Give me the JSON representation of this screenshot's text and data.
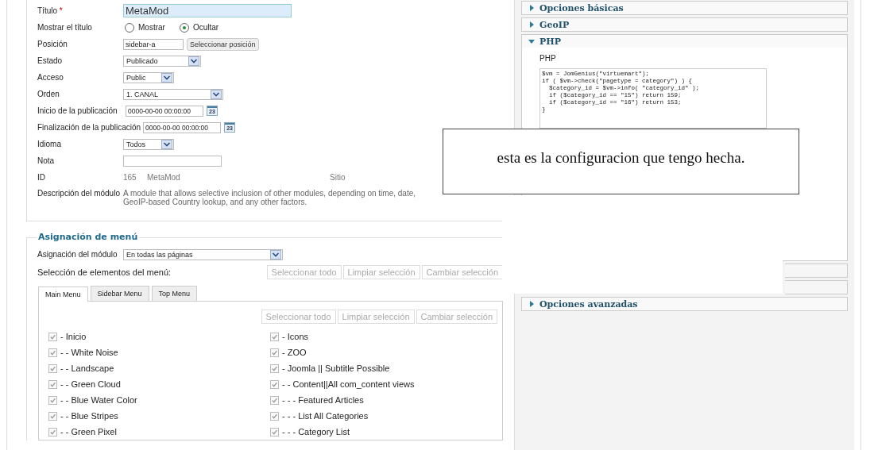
{
  "details": {
    "fields": [
      {
        "kind": "title",
        "label": "Título",
        "mark": "*",
        "value": "MetaMod"
      },
      {
        "kind": "radio",
        "label": "Mostrar el título",
        "options": [
          {
            "label": "Mostrar",
            "selected": false
          },
          {
            "label": "Ocultar",
            "selected": true
          }
        ]
      },
      {
        "kind": "position",
        "label": "Posición",
        "value": "sidebar-a",
        "button": "Seleccionar posición"
      },
      {
        "kind": "select",
        "label": "Estado",
        "value": "Publicado"
      },
      {
        "kind": "select",
        "label": "Acceso",
        "value": "Public"
      },
      {
        "kind": "select",
        "label": "Orden",
        "value": "1. CANAL"
      },
      {
        "kind": "date",
        "label": "Inicio de la publicación",
        "value": "0000-00-00 00:00:00",
        "day": "23"
      },
      {
        "kind": "date",
        "label": "Finalización de la publicación",
        "value": "0000-00-00 00:00:00",
        "day": "23"
      },
      {
        "kind": "select",
        "label": "Idioma",
        "value": "Todos"
      },
      {
        "kind": "text",
        "label": "Nota"
      },
      {
        "kind": "info",
        "label": "ID",
        "values": [
          "165",
          "MetaMod",
          "Sitio"
        ]
      },
      {
        "kind": "description",
        "label": "Descripción del módulo",
        "text": "A module that allows selective inclusion of other modules, depending on time, date, GeoIP-based Country lookup, and any other factors."
      }
    ]
  },
  "menu_assignment": {
    "legend": "Asignación de menú",
    "assignment_label": "Asignación del módulo",
    "assignment_value": "En todas las páginas",
    "selection_label": "Selección de elementos del menú:",
    "buttons": [
      "Seleccionar todo",
      "Limpiar selección",
      "Cambiar selección"
    ],
    "tabs": [
      {
        "label": "Main Menu",
        "selected": true
      },
      {
        "label": "Sidebar Menu",
        "selected": false
      },
      {
        "label": "Top Menu",
        "selected": false
      }
    ],
    "tab_buttons": [
      "Seleccionar todo",
      "Limpiar selección",
      "Cambiar selección"
    ],
    "columns": [
      [
        {
          "label": "- Inicio",
          "checked": true
        },
        {
          "label": "- - White Noise",
          "checked": true
        },
        {
          "label": "- - Landscape",
          "checked": true
        },
        {
          "label": "- - Green Cloud",
          "checked": true
        },
        {
          "label": "- - Blue Water Color",
          "checked": true
        },
        {
          "label": "- - Blue Stripes",
          "checked": true
        },
        {
          "label": "- - Green Pixel",
          "checked": true
        }
      ],
      [
        {
          "label": "- Icons",
          "checked": true
        },
        {
          "label": "- ZOO",
          "checked": true
        },
        {
          "label": "- Joomla || Subtitle Possible",
          "checked": true
        },
        {
          "label": "- - Content||All com_content views",
          "checked": true
        },
        {
          "label": "- - - Featured Articles",
          "checked": true
        },
        {
          "label": "- - - List All Categories",
          "checked": true
        },
        {
          "label": "- - - Category List",
          "checked": true
        }
      ]
    ]
  },
  "panels": [
    {
      "title": "Opciones básicas",
      "expanded": false
    },
    {
      "title": "GeoIP",
      "expanded": false
    },
    {
      "title": "PHP",
      "expanded": true,
      "field_label": "PHP",
      "code": "$vm = JomGenius(\"virtuemart\");\nif ( $vm->check(\"pagetype = category\") ) {\n  $category_id = $vm->info( \"category_id\" );\n  if ($category_id == \"15\") return 159;\n  if ($category_id == \"16\") return 153;\n}"
    },
    {
      "expanded": false
    },
    {
      "expanded": false
    },
    {
      "title": "Opciones avanzadas",
      "expanded": false
    }
  ],
  "annotation": {
    "text": "esta es la configuracion que tengo hecha."
  }
}
